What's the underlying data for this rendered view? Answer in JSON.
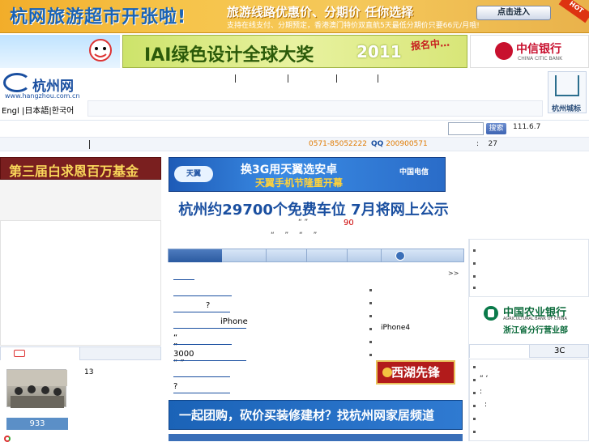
{
  "top_banner": {
    "headline": "杭网旅游超市开张啦!",
    "slogan": "旅游线路优惠价、分期价 任你选择",
    "detail": "支持在线支付、分期预定，香港澳门特价双直航5天最低分期价只要66元/月哦!",
    "enter_button": "点击进入",
    "hot_badge": "HOT"
  },
  "ad_row": {
    "award": "IAI绿色设计全球大奖",
    "year": "2011",
    "signup": "报名中…",
    "bank": "中信银行",
    "bank_en": "CHINA CITIC BANK"
  },
  "site": {
    "logo_text": "杭州网",
    "logo_url": "www.hangzhou.com.cn",
    "languages": "Engl  |日本語|한국어",
    "city_badge": "杭州城标"
  },
  "search": {
    "button": "搜索",
    "ip_info": "111.6.7"
  },
  "info_bar": {
    "phone": "0571-85052222",
    "qq_label": "QQ",
    "qq_number": "200900571",
    "count_label": ":",
    "count_value": "27"
  },
  "left": {
    "ad_title": "第三届白求恩百万基金",
    "news_count": "13",
    "photo_caption": "933"
  },
  "center": {
    "mobile_ad_title": "换3G用天翼选安卓",
    "mobile_ad_sub": "天翼手机节隆重开幕",
    "mobile_ad_brand": "天翼",
    "mobile_ad_telecom": "中国电信",
    "headline": "杭州约29700个免费车位  7月将网上公示",
    "sub1": "“  ”",
    "sub1_number": "90",
    "sub2": "“  ”  “  ”",
    "more": ">>",
    "news_rows": [
      {
        "text": "",
        "underline": [
          0,
          26
        ]
      },
      {
        "text": "",
        "underline": [
          0,
          72
        ]
      },
      {
        "text": "?",
        "underline": [
          0,
          70
        ]
      },
      {
        "text": "iPhone",
        "underline": [
          0,
          90
        ]
      },
      {
        "text": "“   ”",
        "underline": [
          0,
          72
        ]
      },
      {
        "text": "3000      “  ”",
        "underline": [
          0,
          90
        ]
      },
      {
        "text": "",
        "underline": [
          0,
          70
        ]
      },
      {
        "text": "?",
        "underline": [
          0,
          70
        ]
      }
    ],
    "side_items": [
      "",
      "",
      "",
      "iPhone4",
      "",
      ""
    ],
    "xihu_label": "西湖先锋",
    "bottom_ad": "一起团购，砍价买装修建材？找杭州网家居频道"
  },
  "right": {
    "bank2_name": "中国农业银行",
    "bank2_en": "AGRICULTURAL BANK OF CHINA",
    "bank2_branch": "浙江省分行营业部",
    "tab_label": "3C",
    "list_text": [
      "",
      "“ ‘",
      ":",
      ":",
      "",
      ""
    ]
  }
}
